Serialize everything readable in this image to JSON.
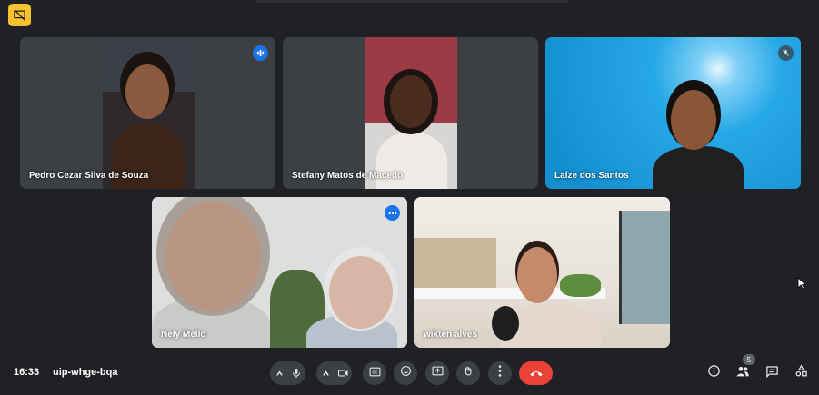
{
  "app": {
    "badge_icon": "meet-presentation-off-icon",
    "accent": "#f9c12d"
  },
  "participants": [
    {
      "name": "Pedro Cezar Silva de Souza",
      "status": "speaking",
      "bg": "#3c4043"
    },
    {
      "name": "Stefany Matos de Macedo",
      "status": "none",
      "bg": "#3c4043"
    },
    {
      "name": "Laíze dos Santos",
      "status": "muted",
      "bg": "#1da1e0"
    },
    {
      "name": "Nely Mello",
      "status": "more-options",
      "bg": "#3c4043"
    },
    {
      "name": "wikten alves",
      "status": "none",
      "bg": "#3c4043"
    }
  ],
  "meeting": {
    "time": "16:33",
    "separator": "|",
    "code": "uip-whge-bqa"
  },
  "controls": {
    "mic": "microphone-icon",
    "camera": "camera-icon",
    "captions": "captions-icon",
    "emoji": "emoji-icon",
    "present": "present-screen-icon",
    "hand": "raise-hand-icon",
    "more": "more-options-icon",
    "end_call": "end-call-icon",
    "end_color": "#ea4335"
  },
  "right_controls": {
    "info": "info-icon",
    "people": "people-icon",
    "people_count": "5",
    "chat": "chat-icon",
    "activities": "activities-icon"
  }
}
